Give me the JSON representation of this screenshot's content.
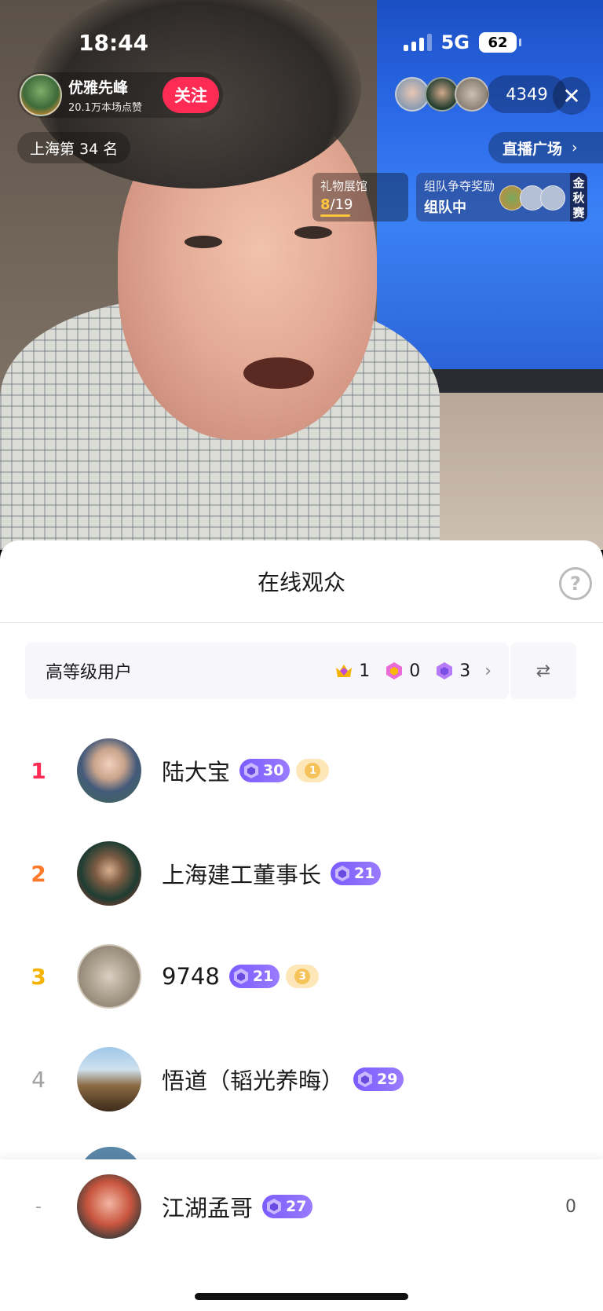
{
  "status_bar": {
    "time": "18:44",
    "network": "5G",
    "battery": "62"
  },
  "host": {
    "name": "优雅先峰",
    "likes": "20.1万本场点赞",
    "follow_label": "关注"
  },
  "viewer_count": "4349",
  "rank_label": "上海第 34 名",
  "plaza_label": "直播广场",
  "gift_card": {
    "title": "礼物展馆",
    "current": "8",
    "total": "/19"
  },
  "team_card": {
    "title": "组队争夺奖励",
    "status": "组队中",
    "tag": "金秋赛"
  },
  "sheet": {
    "title": "在线观众",
    "high_level": {
      "label": "高等级用户",
      "stats": [
        "1",
        "0",
        "3"
      ]
    }
  },
  "viewers": [
    {
      "rank": "1",
      "name": "陆大宝",
      "level": "30",
      "fan_badge": "1"
    },
    {
      "rank": "2",
      "name": "上海建工董事长",
      "level": "21"
    },
    {
      "rank": "3",
      "name": "9748",
      "level": "21",
      "fan_badge": "3"
    },
    {
      "rank": "4",
      "name": "悟道（韬光养晦）",
      "level": "29"
    }
  ],
  "self_row": {
    "rank": "-",
    "name": "江湖孟哥",
    "level": "27",
    "score": "0"
  },
  "colors": {
    "accent": "#fe2c55",
    "level_badge": "#7a5cff"
  }
}
